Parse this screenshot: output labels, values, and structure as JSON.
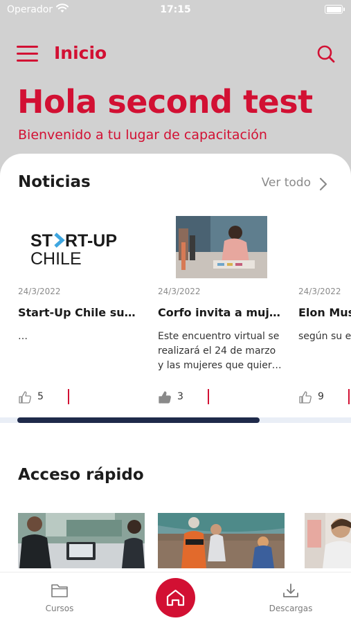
{
  "status_bar": {
    "carrier": "Operador",
    "time": "17:15"
  },
  "header": {
    "title": "Inicio"
  },
  "hero": {
    "greeting": "Hola second test",
    "subtitle": "Bienvenido a tu lugar de capacitación"
  },
  "news": {
    "title": "Noticias",
    "see_all": "Ver todo",
    "logo_line1_a": "ST",
    "logo_line1_b": "RT-UP",
    "logo_line2": "CHILE",
    "items": [
      {
        "date": "24/3/2022",
        "title": "Start-Up Chile sum…",
        "desc": "…",
        "likes": "5"
      },
      {
        "date": "24/3/2022",
        "title": "Corfo invita a muje…",
        "desc": "Este encuentro virtual se realizará el 24 de marzo y las mujeres que quier…",
        "likes": "3"
      },
      {
        "date": "24/3/2022",
        "title": "Elon Mus",
        "desc": "según su e",
        "likes": "9"
      }
    ]
  },
  "quick_access": {
    "title": "Acceso rápido"
  },
  "bottom_nav": {
    "courses": "Cursos",
    "downloads": "Descargas"
  },
  "colors": {
    "accent": "#d21033",
    "header_bg": "#d1d1d1",
    "scroll_thumb": "#1f2a4a"
  }
}
